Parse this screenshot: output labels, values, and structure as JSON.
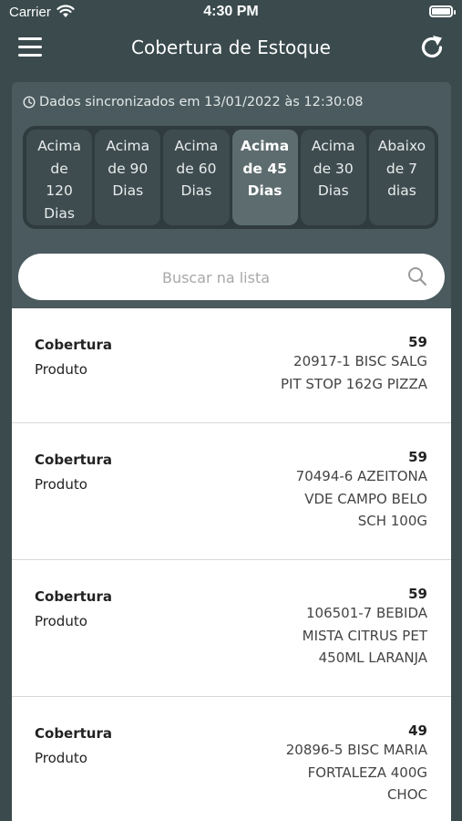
{
  "status_bar": {
    "carrier": "Carrier",
    "time": "4:30 PM"
  },
  "header": {
    "title": "Cobertura de Estoque",
    "menu_icon": "hamburger-icon",
    "refresh_icon": "refresh-icon"
  },
  "sync_text": "Dados sincronizados em 13/01/2022 às 12:30:08",
  "tabs": [
    {
      "lines": [
        "Acima",
        "de",
        "120",
        "Dias"
      ],
      "active": false
    },
    {
      "lines": [
        "Acima",
        "de 90",
        "Dias"
      ],
      "active": false
    },
    {
      "lines": [
        "Acima",
        "de 60",
        "Dias"
      ],
      "active": false
    },
    {
      "lines": [
        "Acima",
        "de 45",
        "Dias"
      ],
      "active": true
    },
    {
      "lines": [
        "Acima",
        "de 30",
        "Dias"
      ],
      "active": false
    },
    {
      "lines": [
        "Abaixo",
        "de 7",
        "dias"
      ],
      "active": false
    }
  ],
  "search": {
    "placeholder": "Buscar na lista"
  },
  "list": {
    "label_cobertura": "Cobertura",
    "label_produto": "Produto",
    "items": [
      {
        "cobertura": "59",
        "produto_lines": [
          "20917-1 BISC SALG",
          "PIT STOP 162G PIZZA"
        ]
      },
      {
        "cobertura": "59",
        "produto_lines": [
          "70494-6 AZEITONA",
          "VDE CAMPO BELO",
          "SCH 100G"
        ]
      },
      {
        "cobertura": "59",
        "produto_lines": [
          "106501-7 BEBIDA",
          "MISTA CITRUS PET",
          "450ML LARANJA"
        ]
      },
      {
        "cobertura": "49",
        "produto_lines": [
          "20896-5 BISC MARIA",
          "FORTALEZA 400G",
          "CHOC"
        ]
      }
    ]
  },
  "colors": {
    "background": "#3a4a4d",
    "panel": "#4a5a5e",
    "tab_bar": "#2f3b3e",
    "tab_active": "#5d6c6f"
  }
}
